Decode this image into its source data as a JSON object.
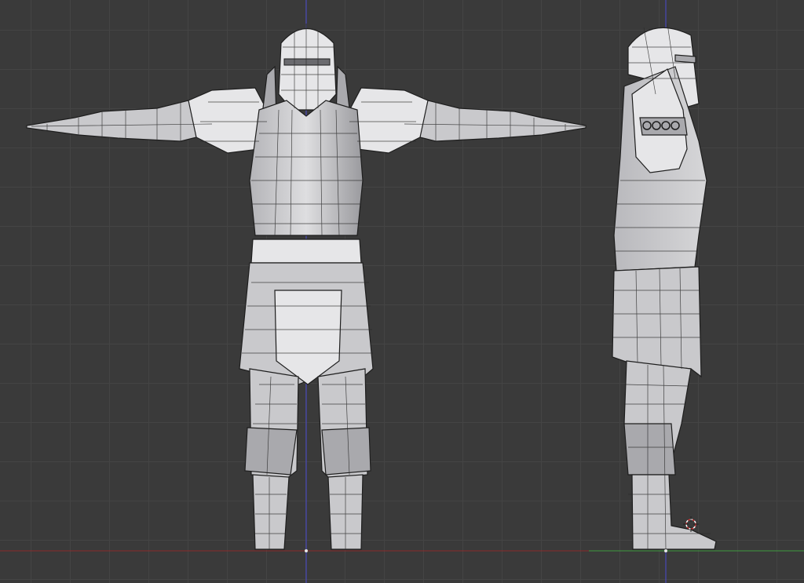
{
  "viewport": {
    "views": [
      "front-view",
      "side-view"
    ],
    "colors": {
      "background": "#3a3a3a",
      "grid": "#444444",
      "mesh": "#c9c9cc",
      "x_axis": "#8b2b2b",
      "y_axis": "#3f9a3f",
      "z_axis": "#4a4ad0"
    },
    "icons": {
      "cursor": "3d-cursor-icon"
    }
  }
}
